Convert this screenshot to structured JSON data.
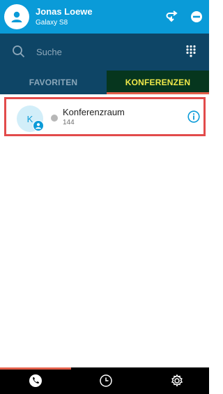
{
  "header": {
    "user_name": "Jonas Loewe",
    "device": "Galaxy S8",
    "avatar_icon": "person-icon",
    "actions": [
      "call-forward-icon",
      "do-not-disturb-icon"
    ]
  },
  "search": {
    "placeholder": "Suche",
    "icon": "search-icon",
    "dialpad_icon": "dialpad-icon"
  },
  "tabs": [
    {
      "label": "FAVORITEN",
      "active": false
    },
    {
      "label": "KONFERENZEN",
      "active": true
    }
  ],
  "conference_list": [
    {
      "initial": "K",
      "title": "Konferenzraum",
      "number": "144",
      "status": "offline",
      "status_color": "#b7b7b7",
      "info_icon": "info-icon"
    }
  ],
  "bottom_nav": [
    {
      "icon": "phone-icon",
      "active": true
    },
    {
      "icon": "history-icon",
      "active": false
    },
    {
      "icon": "settings-icon",
      "active": false
    }
  ],
  "colors": {
    "header_blue": "#0a9bd8",
    "dark_blue": "#0e4566",
    "active_tab_bg": "#06361e",
    "active_tab_text": "#f0e94a",
    "accent_red": "#e35f4a",
    "selection_border": "#e24b4b"
  }
}
